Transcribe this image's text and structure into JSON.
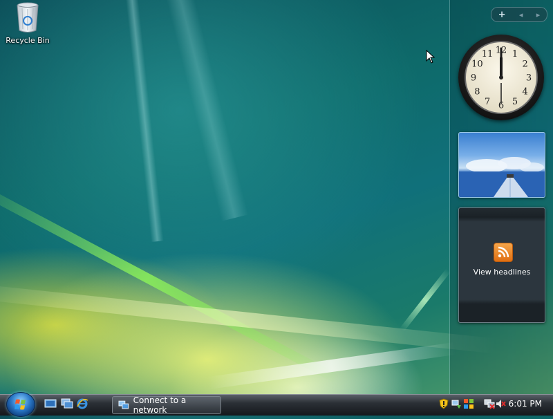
{
  "desktop": {
    "icons": [
      {
        "label": "Recycle Bin",
        "icon": "recycle-bin-icon"
      }
    ]
  },
  "sidebar": {
    "controls": {
      "add": "+",
      "prev": "◂",
      "next": "▸"
    },
    "clock": {
      "numbers": [
        "12",
        "1",
        "2",
        "3",
        "4",
        "5",
        "6",
        "7",
        "8",
        "9",
        "10",
        "11"
      ]
    },
    "feed": {
      "label": "View headlines",
      "icon": "rss-feed-icon"
    }
  },
  "taskbar": {
    "start_icon": "windows-start-orb",
    "quick_launch": [
      "show-desktop-icon",
      "switch-windows-icon",
      "internet-explorer-icon"
    ],
    "tasks": [
      {
        "label": "Connect to a network",
        "icon": "network-connect-icon"
      }
    ],
    "tray_icons": [
      "security-alert-icon",
      "network-status-icon",
      "windows-update-icon",
      "network-disconnected-icon",
      "volume-muted-icon"
    ],
    "time": "6:01 PM"
  },
  "colors": {
    "accent": "#2a78c8",
    "feed_orange": "#e06f12"
  }
}
